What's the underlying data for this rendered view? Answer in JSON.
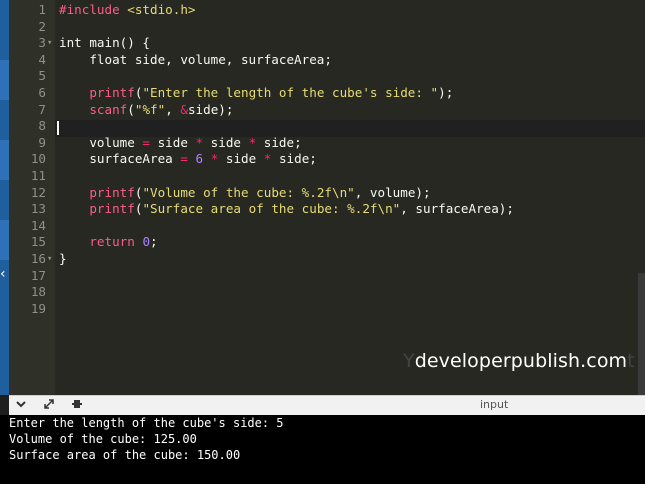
{
  "editor": {
    "lines": [
      {
        "n": "1",
        "fold": "",
        "parts": [
          [
            "inc",
            "#include "
          ],
          [
            "str",
            "<stdio.h>"
          ]
        ]
      },
      {
        "n": "2",
        "fold": "",
        "parts": []
      },
      {
        "n": "3",
        "fold": "▾",
        "parts": [
          [
            "kw",
            "int main() {"
          ]
        ]
      },
      {
        "n": "4",
        "fold": "",
        "parts": [
          [
            "kw",
            "    float side, volume, surfaceArea;"
          ]
        ]
      },
      {
        "n": "5",
        "fold": "",
        "parts": []
      },
      {
        "n": "6",
        "fold": "",
        "parts": [
          [
            "kw",
            "    "
          ],
          [
            "fn",
            "printf"
          ],
          [
            "kw",
            "("
          ],
          [
            "str",
            "\"Enter the length of the cube's side: \""
          ],
          [
            "kw",
            ");"
          ]
        ]
      },
      {
        "n": "7",
        "fold": "",
        "parts": [
          [
            "kw",
            "    "
          ],
          [
            "fn",
            "scanf"
          ],
          [
            "kw",
            "("
          ],
          [
            "str",
            "\"%f\""
          ],
          [
            "kw",
            ", "
          ],
          [
            "op",
            "&"
          ],
          [
            "kw",
            "side);"
          ]
        ]
      },
      {
        "n": "8",
        "fold": "",
        "parts": []
      },
      {
        "n": "9",
        "fold": "",
        "parts": [
          [
            "kw",
            "    volume "
          ],
          [
            "op",
            "="
          ],
          [
            "kw",
            " side "
          ],
          [
            "op",
            "*"
          ],
          [
            "kw",
            " side "
          ],
          [
            "op",
            "*"
          ],
          [
            "kw",
            " side;"
          ]
        ]
      },
      {
        "n": "10",
        "fold": "",
        "parts": [
          [
            "kw",
            "    surfaceArea "
          ],
          [
            "op",
            "="
          ],
          [
            "kw",
            " "
          ],
          [
            "num",
            "6"
          ],
          [
            "kw",
            " "
          ],
          [
            "op",
            "*"
          ],
          [
            "kw",
            " side "
          ],
          [
            "op",
            "*"
          ],
          [
            "kw",
            " side;"
          ]
        ]
      },
      {
        "n": "11",
        "fold": "",
        "parts": []
      },
      {
        "n": "12",
        "fold": "",
        "parts": [
          [
            "kw",
            "    "
          ],
          [
            "fn",
            "printf"
          ],
          [
            "kw",
            "("
          ],
          [
            "str",
            "\"Volume of the cube: %.2f\\n\""
          ],
          [
            "kw",
            ", volume);"
          ]
        ]
      },
      {
        "n": "13",
        "fold": "",
        "parts": [
          [
            "kw",
            "    "
          ],
          [
            "fn",
            "printf"
          ],
          [
            "kw",
            "("
          ],
          [
            "str",
            "\"Surface area of the cube: %.2f\\n\""
          ],
          [
            "kw",
            ", surfaceArea);"
          ]
        ]
      },
      {
        "n": "14",
        "fold": "",
        "parts": []
      },
      {
        "n": "15",
        "fold": "",
        "parts": [
          [
            "kw",
            "    "
          ],
          [
            "fn",
            "return"
          ],
          [
            "kw",
            " "
          ],
          [
            "num",
            "0"
          ],
          [
            "kw",
            ";"
          ]
        ]
      },
      {
        "n": "16",
        "fold": "▾",
        "parts": [
          [
            "kw",
            "}"
          ]
        ]
      },
      {
        "n": "17",
        "fold": "",
        "parts": []
      },
      {
        "n": "18",
        "fold": "",
        "parts": []
      },
      {
        "n": "19",
        "fold": "",
        "parts": []
      }
    ],
    "watermark_prefix": "Y",
    "watermark_text": "developerpublish.com",
    "watermark_suffix": "t"
  },
  "toolbar": {
    "collapse_icon": "chevron-down-icon",
    "expand_icon": "expand-arrows-icon",
    "settings_icon": "settings-icon",
    "input_label": "input"
  },
  "console": {
    "output": [
      "Enter the length of the cube's side: 5",
      "Volume of the cube: 125.00",
      "Surface area of the cube: 150.00"
    ]
  },
  "colors": {
    "editor_bg": "#272822",
    "gutter_bg": "#2f3129",
    "console_bg": "#000000",
    "accent_blue": "#1f5f9e",
    "string": "#e6db74",
    "function": "#fd5d86",
    "number": "#ae81ff"
  }
}
